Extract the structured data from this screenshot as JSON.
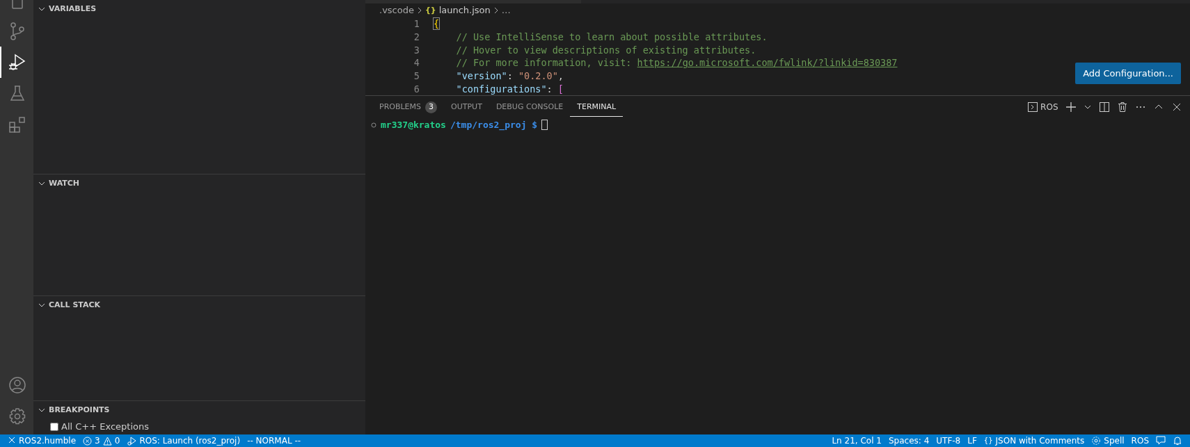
{
  "activity_bar": {
    "items": [
      {
        "kind": "explorer",
        "selected": false
      },
      {
        "kind": "source-control",
        "selected": false
      },
      {
        "kind": "run-debug",
        "selected": true
      },
      {
        "kind": "testing",
        "selected": false
      },
      {
        "kind": "extensions",
        "selected": false
      }
    ],
    "bottom": [
      {
        "kind": "account"
      },
      {
        "kind": "settings"
      }
    ]
  },
  "sidebar": {
    "sections": [
      {
        "title": "VARIABLES",
        "expanded": true
      },
      {
        "title": "WATCH",
        "expanded": true
      },
      {
        "title": "CALL STACK",
        "expanded": true
      },
      {
        "title": "BREAKPOINTS",
        "expanded": true,
        "items": [
          {
            "label": "All C++ Exceptions",
            "checked": false
          }
        ]
      }
    ]
  },
  "editor": {
    "breadcrumb": [
      {
        "kind": "folder",
        "text": ".vscode"
      },
      {
        "kind": "file",
        "icon_text": "{}",
        "text": "launch.json"
      },
      {
        "kind": "more",
        "text": "…"
      }
    ],
    "lines": [
      {
        "number": "1",
        "tokens": [
          {
            "kind": "bracket-match",
            "text": "{"
          }
        ]
      },
      {
        "number": "2",
        "tokens": [
          {
            "kind": "comment",
            "text": "    // Use IntelliSense to learn about possible attributes."
          }
        ]
      },
      {
        "number": "3",
        "tokens": [
          {
            "kind": "comment",
            "text": "    // Hover to view descriptions of existing attributes."
          }
        ]
      },
      {
        "number": "4",
        "tokens": [
          {
            "kind": "comment",
            "text": "    // For more information, visit: "
          },
          {
            "kind": "link",
            "text": "https://go.microsoft.com/fwlink/?linkid=830387"
          }
        ]
      },
      {
        "number": "5",
        "tokens": [
          {
            "kind": "key",
            "text": "    \"version\""
          },
          {
            "kind": "punct",
            "text": ": "
          },
          {
            "kind": "string",
            "text": "\"0.2.0\""
          },
          {
            "kind": "punct",
            "text": ","
          }
        ]
      },
      {
        "number": "6",
        "tokens": [
          {
            "kind": "key",
            "text": "    \"configurations\""
          },
          {
            "kind": "punct",
            "text": ": "
          },
          {
            "kind": "bracket2",
            "text": "["
          }
        ]
      }
    ],
    "add_configuration_button": "Add Configuration..."
  },
  "panel": {
    "tabs": [
      {
        "label": "PROBLEMS",
        "badge": "3",
        "selected": false
      },
      {
        "label": "OUTPUT",
        "selected": false
      },
      {
        "label": "DEBUG CONSOLE",
        "selected": false
      },
      {
        "label": "TERMINAL",
        "selected": true
      }
    ],
    "terminal_profile": "ROS",
    "terminal": {
      "user": "mr337@kratos",
      "path": "/tmp/ros2_proj $"
    }
  },
  "status_bar": {
    "left": [
      {
        "kind": "remote",
        "text": "ROS2.humble"
      },
      {
        "kind": "problems",
        "errors": "3",
        "warnings": "0"
      },
      {
        "kind": "launch",
        "text": "ROS: Launch (ros2_proj)"
      },
      {
        "kind": "plain",
        "text": "-- NORMAL --"
      }
    ],
    "right": [
      {
        "kind": "plain",
        "text": "Ln 21, Col 1"
      },
      {
        "kind": "plain",
        "text": "Spaces: 4"
      },
      {
        "kind": "plain",
        "text": "UTF-8"
      },
      {
        "kind": "plain",
        "text": "LF"
      },
      {
        "kind": "language",
        "icon_text": "{}",
        "text": "JSON with Comments"
      },
      {
        "kind": "spell",
        "text": "Spell"
      },
      {
        "kind": "plain",
        "text": "ROS"
      },
      {
        "kind": "feedback"
      },
      {
        "kind": "bell"
      }
    ]
  }
}
